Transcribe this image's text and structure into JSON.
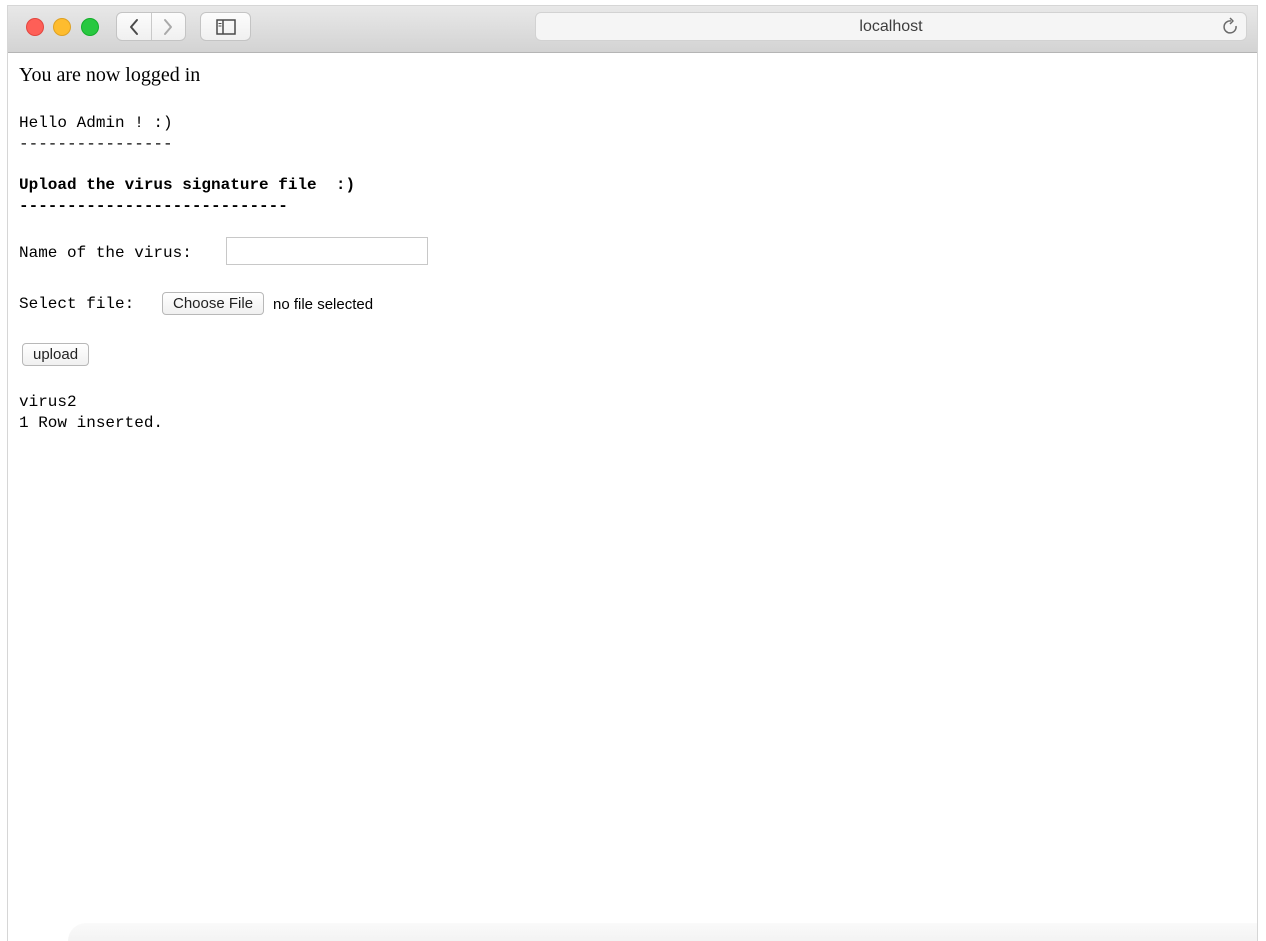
{
  "browser": {
    "address": "localhost",
    "icons": {
      "back": "chevron-left-icon",
      "forward": "chevron-right-icon",
      "sidebar": "sidebar-icon",
      "reload": "reload-icon"
    }
  },
  "page": {
    "status_heading": "You are now logged in",
    "greeting": "Hello Admin ! :)",
    "greeting_rule": "----------------",
    "upload_heading": "Upload the virus signature file  :)",
    "upload_rule": "----------------------------",
    "virus_name_label": "Name of the virus:",
    "virus_name_value": "",
    "select_file_label": "Select file:",
    "choose_file_button": "Choose File",
    "file_status": "no file selected",
    "upload_button": "upload",
    "result_name": "virus2",
    "result_message": "1 Row inserted."
  }
}
